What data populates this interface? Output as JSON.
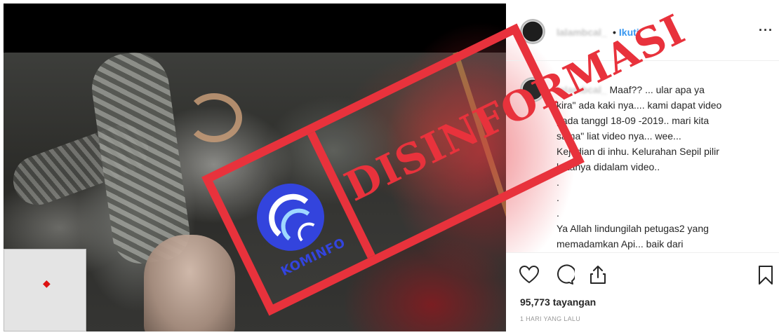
{
  "post": {
    "username": "lalambcal_",
    "separator": "•",
    "follow_label": "Ikuti",
    "more_icon": "more-horizontal-icon"
  },
  "comment": {
    "username": "lalambcal_",
    "lines": [
      "Maaf?? ... ular apa ya",
      "kira\" ada kaki nya.... kami dapat video",
      "pada tanggl 18-09 -2019.. mari kita",
      "sama\" liat video nya... wee...",
      "Kejadian di inhu. Kelurahan Sepil pilir",
      "katanya didalam video.."
    ],
    "dots": [
      ".",
      ".",
      "."
    ],
    "continuation": [
      "Ya Allah lindungilah petugas2 yang",
      "memadamkan Api... baik dari"
    ]
  },
  "actions": {
    "like_icon": "heart-icon",
    "comment_icon": "comment-icon",
    "share_icon": "share-icon",
    "save_icon": "bookmark-icon",
    "views": "95,773 tayangan",
    "timestamp": "1 HARI YANG LALU"
  },
  "stamp": {
    "word": "DISINFORMASI",
    "logo_text": "KOMINFO",
    "color": "#e8323c",
    "logo_color": "#3344dd"
  },
  "colors": {
    "follow": "#3897f0",
    "text": "#262626",
    "muted": "#999999"
  }
}
